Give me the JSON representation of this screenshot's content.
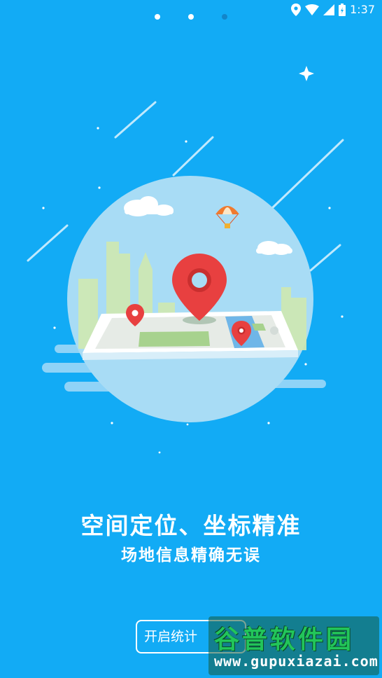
{
  "status_bar": {
    "time": "1:37",
    "icons": [
      "location-icon",
      "wifi-icon",
      "signal-icon",
      "battery-icon"
    ]
  },
  "pager": {
    "total": 3,
    "active_index": 2
  },
  "illustration": {
    "icons": [
      "map-pin-icon",
      "parachute-icon",
      "cloud-icon",
      "sparkle-icon",
      "phone-map-icon"
    ]
  },
  "content": {
    "headline": "空间定位、坐标精准",
    "subline": "场地信息精确无误"
  },
  "actions": {
    "start_button_label": "开启统计"
  },
  "watermark": {
    "title": "谷普软件园",
    "url": "www.gupuxiazai.com"
  },
  "colors": {
    "background": "#12abf5",
    "pin": "#e84040",
    "circle": "#a8dcf5"
  }
}
